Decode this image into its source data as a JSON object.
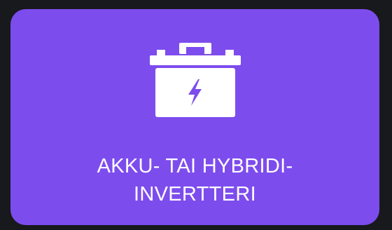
{
  "card": {
    "icon": "battery-charging-icon",
    "label_lines": [
      "AKKU- TAI HYBRIDI-",
      "INVERTTERI"
    ],
    "background_color": "#7d4ced",
    "text_color": "#ffffff"
  },
  "page": {
    "background_color": "#17191c"
  }
}
